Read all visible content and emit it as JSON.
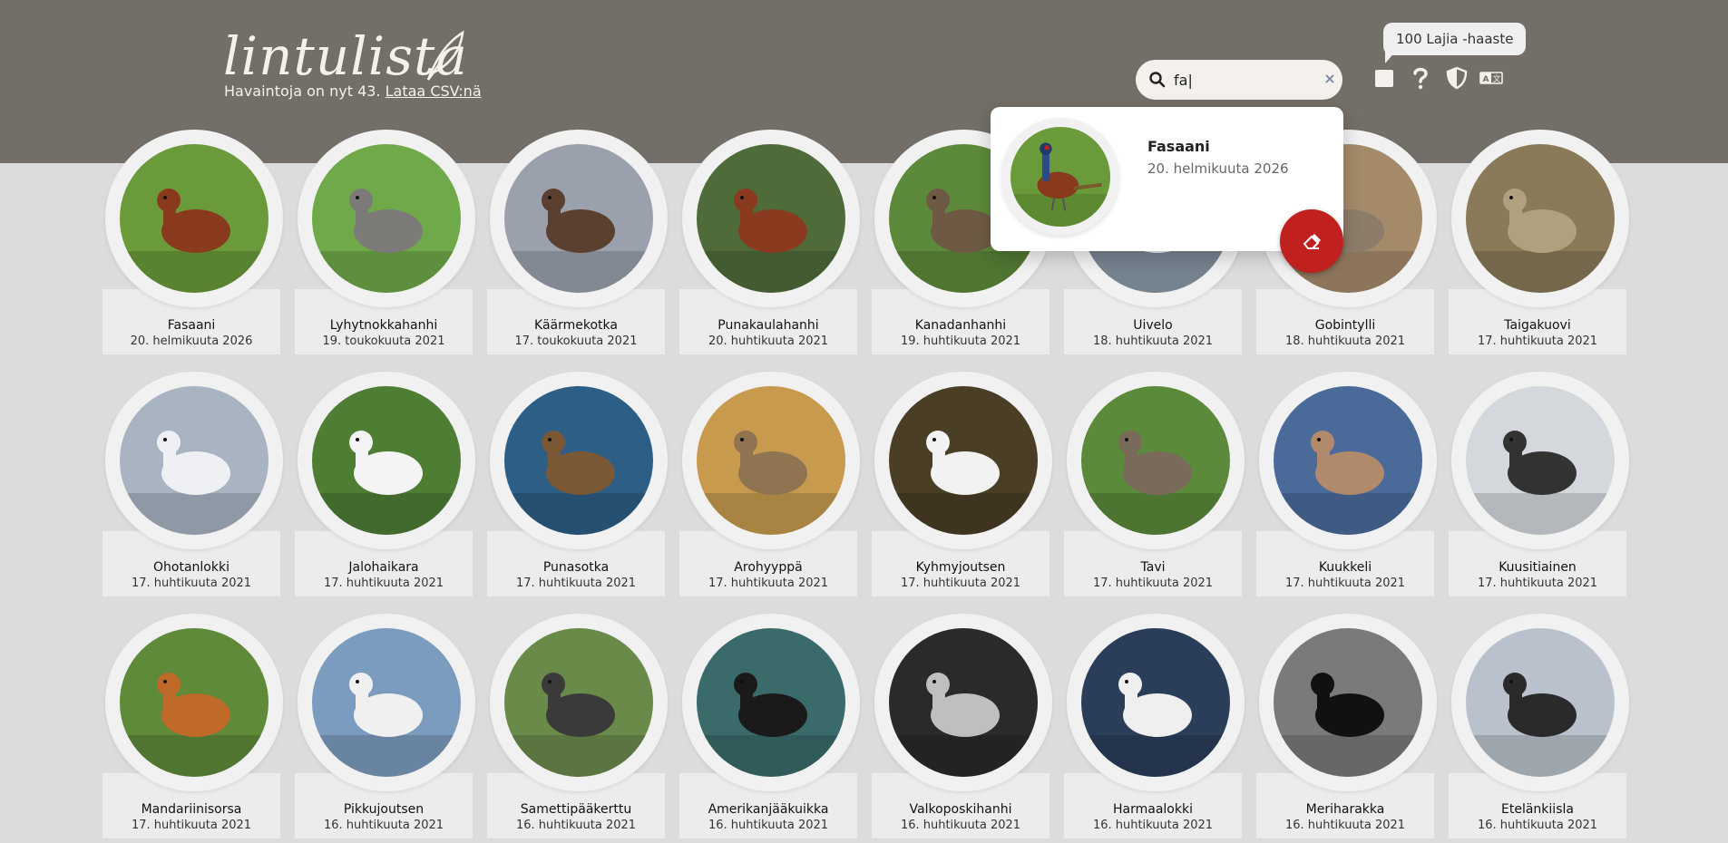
{
  "header": {
    "logo_text": "lintulista",
    "subtitle_prefix": "Havaintoja on nyt 43.",
    "csv_link": "Lataa CSV:nä"
  },
  "search": {
    "value": "fa|",
    "clear_label": "×"
  },
  "tooltip": "100 Lajia -haaste",
  "toolbar_icons": [
    "square-icon",
    "help-icon",
    "shield-icon",
    "translate-icon"
  ],
  "popup": {
    "name": "Fasaani",
    "date": "20. helmikuuta 2026"
  },
  "birds": [
    {
      "name": "Fasaani",
      "date": "20. helmikuuta 2026",
      "bg": "#6a9a3a",
      "fg": "#8a3a1c"
    },
    {
      "name": "Lyhytnokkahanhi",
      "date": "19. toukokuuta 2021",
      "bg": "#6fa94a",
      "fg": "#7d7b78"
    },
    {
      "name": "Käärmekotka",
      "date": "17. toukokuuta 2021",
      "bg": "#9aa1ad",
      "fg": "#5b4030"
    },
    {
      "name": "Punakaulahanhi",
      "date": "20. huhtikuuta 2021",
      "bg": "#4f6b3a",
      "fg": "#8a3a1f"
    },
    {
      "name": "Kanadanhanhi",
      "date": "19. huhtikuuta 2021",
      "bg": "#5d8a3a",
      "fg": "#6e5a44"
    },
    {
      "name": "Uivelo",
      "date": "18. huhtikuuta 2021",
      "bg": "#8a9aa8",
      "fg": "#eaeaea"
    },
    {
      "name": "Gobintylli",
      "date": "18. huhtikuuta 2021",
      "bg": "#a58a6a",
      "fg": "#8d7c6a"
    },
    {
      "name": "Taigakuovi",
      "date": "17. huhtikuuta 2021",
      "bg": "#8a7a5a",
      "fg": "#b0a080"
    },
    {
      "name": "Ohotanlokki",
      "date": "17. huhtikuuta 2021",
      "bg": "#a9b4c2",
      "fg": "#eef0f3"
    },
    {
      "name": "Jalohaikara",
      "date": "17. huhtikuuta 2021",
      "bg": "#4e7d34",
      "fg": "#f4f4f4"
    },
    {
      "name": "Punasotka",
      "date": "17. huhtikuuta 2021",
      "bg": "#2c5e86",
      "fg": "#7a5836"
    },
    {
      "name": "Arohyyppä",
      "date": "17. huhtikuuta 2021",
      "bg": "#c79a4e",
      "fg": "#8e7450"
    },
    {
      "name": "Kyhmyjoutsen",
      "date": "17. huhtikuuta 2021",
      "bg": "#4a3e26",
      "fg": "#f2f2f2"
    },
    {
      "name": "Tavi",
      "date": "17. huhtikuuta 2021",
      "bg": "#5b8a3a",
      "fg": "#7a6a5a"
    },
    {
      "name": "Kuukkeli",
      "date": "17. huhtikuuta 2021",
      "bg": "#4a6a9a",
      "fg": "#b08a6a"
    },
    {
      "name": "Kuusitiainen",
      "date": "17. huhtikuuta 2021",
      "bg": "#d4d8dc",
      "fg": "#333333"
    },
    {
      "name": "Mandariinisorsa",
      "date": "17. huhtikuuta 2021",
      "bg": "#5e8a3a",
      "fg": "#c06a2a"
    },
    {
      "name": "Pikkujoutsen",
      "date": "16. huhtikuuta 2021",
      "bg": "#7b9cbe",
      "fg": "#f0f0f0"
    },
    {
      "name": "Samettipääkerttu",
      "date": "16. huhtikuuta 2021",
      "bg": "#6a8a4a",
      "fg": "#3a3a3a"
    },
    {
      "name": "Amerikanjääkuikka",
      "date": "16. huhtikuuta 2021",
      "bg": "#3a6a6a",
      "fg": "#1a1a1a"
    },
    {
      "name": "Valkoposkihanhi",
      "date": "16. huhtikuuta 2021",
      "bg": "#2a2a2a",
      "fg": "#bfbfbf"
    },
    {
      "name": "Harmaalokki",
      "date": "16. huhtikuuta 2021",
      "bg": "#2a3e5a",
      "fg": "#efefef"
    },
    {
      "name": "Meriharakka",
      "date": "16. huhtikuuta 2021",
      "bg": "#7a7a7a",
      "fg": "#111111"
    },
    {
      "name": "Etelänkiisla",
      "date": "16. huhtikuuta 2021",
      "bg": "#b9c2cc",
      "fg": "#2a2a2a"
    }
  ]
}
